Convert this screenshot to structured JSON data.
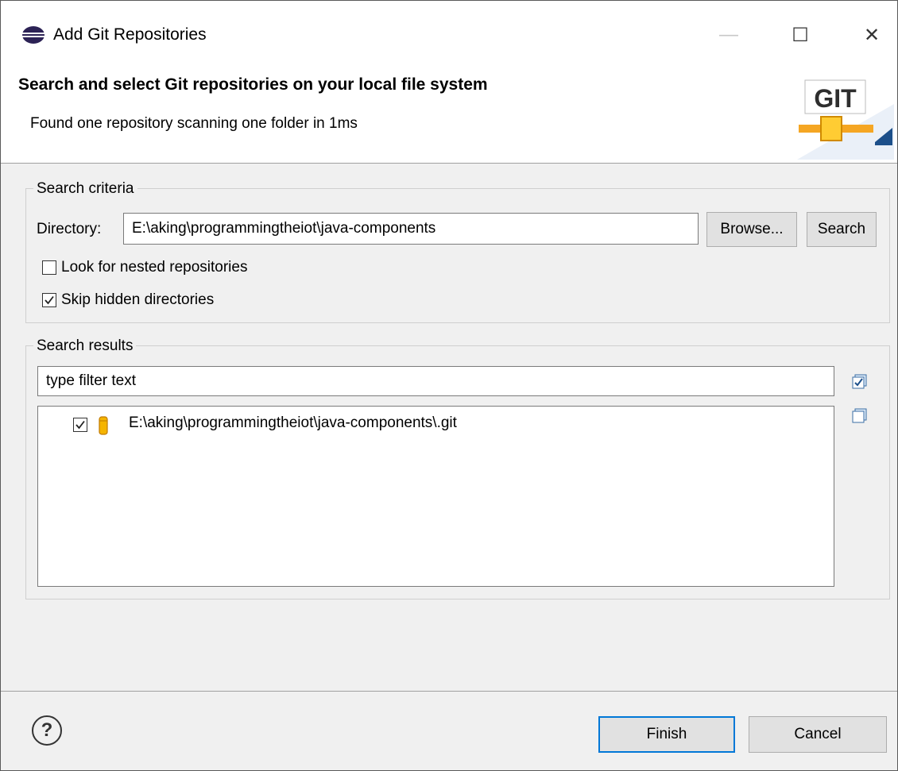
{
  "window": {
    "title": "Add Git Repositories",
    "min_glyph": "—",
    "max_glyph": "☐",
    "close_glyph": "✕"
  },
  "header": {
    "title": "Search and select Git repositories on your local file system",
    "description": "Found one repository scanning one folder in 1ms",
    "logo_text": "GIT"
  },
  "search_criteria": {
    "group_label": "Search criteria",
    "directory_label": "Directory:",
    "directory_value": "E:\\aking\\programmingtheiot\\java-components",
    "browse_label": "Browse...",
    "search_label": "Search",
    "nested_label": "Look for nested repositories",
    "nested_checked": false,
    "skip_hidden_label": "Skip hidden directories",
    "skip_hidden_checked": true
  },
  "search_results": {
    "group_label": "Search results",
    "filter_placeholder": "type filter text",
    "items": [
      {
        "path": "E:\\aking\\programmingtheiot\\java-components\\.git",
        "checked": true,
        "icon": "repository-icon"
      }
    ],
    "select_all_icon": "select-all-icon",
    "deselect_all_icon": "deselect-all-icon"
  },
  "footer": {
    "help_glyph": "?",
    "finish_label": "Finish",
    "cancel_label": "Cancel"
  },
  "colors": {
    "accent": "#0078d7",
    "logo_green": "#2e7d32",
    "pipe_orange": "#f5a623",
    "repo_icon": "#f5b400"
  }
}
